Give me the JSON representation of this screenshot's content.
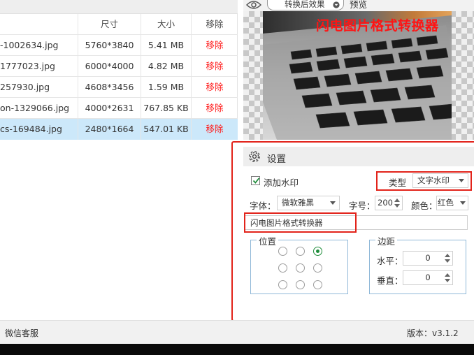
{
  "table": {
    "headers": {
      "dimensions": "尺寸",
      "size": "大小",
      "remove": "移除"
    },
    "rows": [
      {
        "name": "-1002634.jpg",
        "dimensions": "5760*3840",
        "size": "5.41 MB",
        "remove": "移除"
      },
      {
        "name": "1777023.jpg",
        "dimensions": "6000*4000",
        "size": "4.82 MB",
        "remove": "移除"
      },
      {
        "name": "257930.jpg",
        "dimensions": "4608*3456",
        "size": "1.59 MB",
        "remove": "移除"
      },
      {
        "name": "on-1329066.jpg",
        "dimensions": "4000*2631",
        "size": "767.85 KB",
        "remove": "移除"
      },
      {
        "name": "cs-169484.jpg",
        "dimensions": "2480*1664",
        "size": "547.01 KB",
        "remove": "移除",
        "selected": true
      }
    ]
  },
  "preview": {
    "effect_select": "转换后效果",
    "label": "预览",
    "watermark_text": "闪电图片格式转换器"
  },
  "settings": {
    "title": "设置",
    "add_watermark": {
      "label": "添加水印",
      "checked": true
    },
    "type": {
      "label": "类型",
      "value": "文字水印"
    },
    "font": {
      "label": "字体：",
      "value": "微软雅黑"
    },
    "font_size": {
      "label": "字号：",
      "value": "200"
    },
    "color": {
      "label": "颜色：",
      "value": "红色"
    },
    "watermark_text": "闪电图片格式转换器",
    "position": {
      "label": "位置",
      "selected_index": 2
    },
    "margin": {
      "label": "边距",
      "horizontal": {
        "label": "水平：",
        "value": "0"
      },
      "vertical": {
        "label": "垂直：",
        "value": "0"
      }
    }
  },
  "status": {
    "wechat": "微信客服",
    "version": "版本：v3.1.2"
  },
  "colors": {
    "accent_red": "#e2231a",
    "remove_red": "#ff1a1a",
    "selected_row": "#cce8fa"
  }
}
